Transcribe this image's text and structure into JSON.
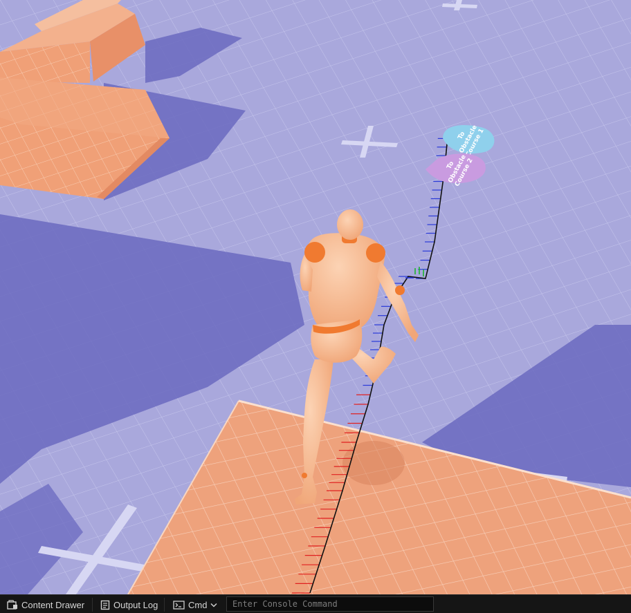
{
  "viewport": {
    "signs": [
      {
        "line1": "To",
        "line2": "Obstacle",
        "line3": "Course 1",
        "color": "#8fd0ec"
      },
      {
        "line1": "To",
        "line2": "Obstacle",
        "line3": "Course 2",
        "color": "#c99be0"
      }
    ],
    "colors": {
      "floor": "#a9a8dc",
      "shadow": "#6b6ac0",
      "block": "#f0a077",
      "mannequin": "#f7b58a",
      "joints": "#f07a30",
      "trajectory": "#111111",
      "trajectory_ticks_red": "#e02020",
      "trajectory_ticks_blue": "#2a3ad8"
    }
  },
  "bottom_bar": {
    "content_drawer_label": "Content Drawer",
    "output_log_label": "Output Log",
    "cmd_label": "Cmd",
    "console_placeholder": "Enter Console Command",
    "icons": [
      "content-drawer-icon",
      "output-log-icon",
      "terminal-icon",
      "chevron-down-icon"
    ]
  }
}
